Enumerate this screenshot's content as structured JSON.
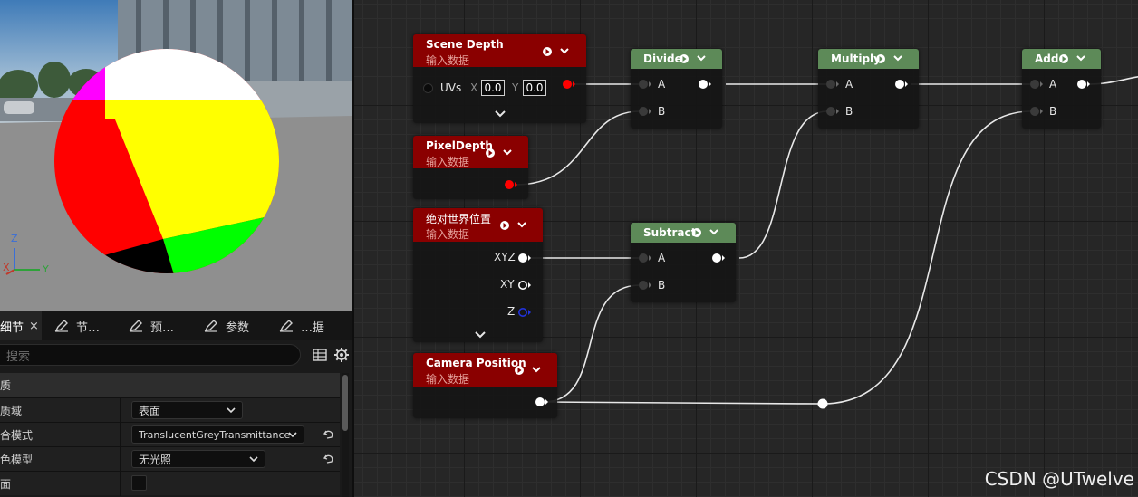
{
  "viewport": {
    "axis_labels": {
      "z": "Z",
      "x": "X",
      "y": "Y"
    },
    "colors": {
      "sky": "#5c8ab5",
      "ground": "#8e8e8e",
      "white": "#ffffff",
      "yellow": "#ffff00",
      "red": "#ff0000",
      "magenta": "#ff00ff",
      "green": "#00ff00",
      "black": "#000000"
    }
  },
  "details": {
    "tabs": [
      {
        "label": "细节",
        "close": "×",
        "icon": "details-icon"
      },
      {
        "label": "节…",
        "icon": "pencil-icon"
      },
      {
        "label": "预…",
        "icon": "pencil-icon"
      },
      {
        "label": "参数",
        "icon": "pencil-icon"
      },
      {
        "label": "…据",
        "icon": "pencil-icon"
      }
    ],
    "search_placeholder": "搜索",
    "section": "材质",
    "properties": [
      {
        "label": "材质域",
        "value": "表面"
      },
      {
        "label": "混合模式",
        "value": "TranslucentGreyTransmittance"
      },
      {
        "label": "着色模型",
        "value": "无光照"
      },
      {
        "label": "双面",
        "value": ""
      }
    ]
  },
  "graph": {
    "nodes": {
      "scene_depth": {
        "title": "Scene Depth",
        "subtitle": "输入数据",
        "uv_label": "UVs",
        "x_label": "X",
        "x_value": "0.0",
        "y_label": "Y",
        "y_value": "0.0"
      },
      "pixel_depth": {
        "title": "PixelDepth",
        "subtitle": "输入数据"
      },
      "abs_world_pos": {
        "title": "绝对世界位置",
        "subtitle": "输入数据",
        "pins": [
          "XYZ",
          "XY",
          "Z"
        ]
      },
      "camera_position": {
        "title": "Camera Position",
        "subtitle": "输入数据"
      },
      "divide": {
        "title": "Divide",
        "pin_a": "A",
        "pin_b": "B"
      },
      "multiply": {
        "title": "Multiply",
        "pin_a": "A",
        "pin_b": "B"
      },
      "subtract": {
        "title": "Subtract",
        "pin_a": "A",
        "pin_b": "B"
      },
      "add": {
        "title": "Add",
        "pin_a": "A",
        "pin_b": "B"
      }
    },
    "watermark": "CSDN @UTwelve"
  }
}
